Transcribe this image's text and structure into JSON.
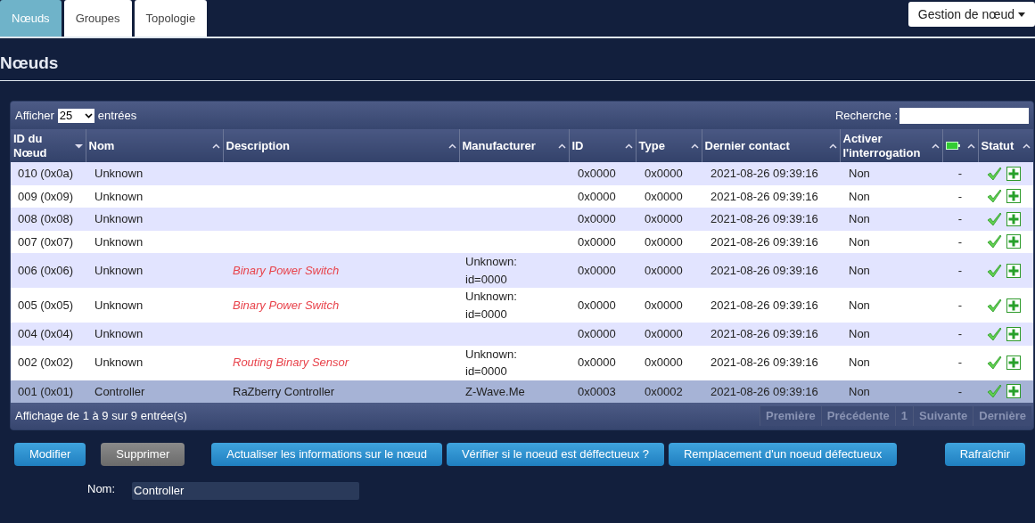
{
  "tabs": [
    {
      "label": "Nœuds",
      "selected": true
    },
    {
      "label": "Groupes",
      "selected": false
    },
    {
      "label": "Topologie",
      "selected": false
    }
  ],
  "menu_button": {
    "label": "Gestion de nœud"
  },
  "heading": "Nœuds",
  "table_controls": {
    "show_label": "Afficher",
    "page_size": "25",
    "entries_label": "entrées",
    "search_label": "Recherche :"
  },
  "table": {
    "columns": [
      {
        "label": "ID du Nœud",
        "sorted_desc": true,
        "kind": "text"
      },
      {
        "label": "Nom",
        "sorted_desc": false,
        "kind": "text"
      },
      {
        "label": "Description",
        "sorted_desc": false,
        "kind": "text"
      },
      {
        "label": "Manufacturer",
        "sorted_desc": false,
        "kind": "text"
      },
      {
        "label": "ID",
        "sorted_desc": false,
        "kind": "text"
      },
      {
        "label": "Type",
        "sorted_desc": false,
        "kind": "text"
      },
      {
        "label": "Dernier contact",
        "sorted_desc": false,
        "kind": "text"
      },
      {
        "label": "Activer l'interrogation",
        "sorted_desc": false,
        "kind": "text"
      },
      {
        "sorted_desc": false,
        "kind": "battery"
      },
      {
        "label": "Statut",
        "sorted_desc": false,
        "kind": "text"
      }
    ],
    "rows": [
      {
        "node_id": "010 (0x0a)",
        "name": "Unknown",
        "id": "0x0000",
        "type": "0x0000",
        "last_contact": "2021-08-26 09:39:16",
        "polling": "Non",
        "battery": "-",
        "selected": false
      },
      {
        "node_id": "009 (0x09)",
        "name": "Unknown",
        "id": "0x0000",
        "type": "0x0000",
        "last_contact": "2021-08-26 09:39:16",
        "polling": "Non",
        "battery": "-",
        "selected": false
      },
      {
        "node_id": "008 (0x08)",
        "name": "Unknown",
        "id": "0x0000",
        "type": "0x0000",
        "last_contact": "2021-08-26 09:39:16",
        "polling": "Non",
        "battery": "-",
        "selected": false
      },
      {
        "node_id": "007 (0x07)",
        "name": "Unknown",
        "id": "0x0000",
        "type": "0x0000",
        "last_contact": "2021-08-26 09:39:16",
        "polling": "Non",
        "battery": "-",
        "selected": false
      },
      {
        "node_id": "006 (0x06)",
        "name": "Unknown",
        "description": "Binary Power Switch",
        "unknown_device": true,
        "manufacturer": "Unknown: id=0000",
        "id": "0x0000",
        "type": "0x0000",
        "last_contact": "2021-08-26 09:39:16",
        "polling": "Non",
        "battery": "-",
        "selected": false
      },
      {
        "node_id": "005 (0x05)",
        "name": "Unknown",
        "description": "Binary Power Switch",
        "unknown_device": true,
        "manufacturer": "Unknown: id=0000",
        "id": "0x0000",
        "type": "0x0000",
        "last_contact": "2021-08-26 09:39:16",
        "polling": "Non",
        "battery": "-",
        "selected": false
      },
      {
        "node_id": "004 (0x04)",
        "name": "Unknown",
        "id": "0x0000",
        "type": "0x0000",
        "last_contact": "2021-08-26 09:39:16",
        "polling": "Non",
        "battery": "-",
        "selected": false
      },
      {
        "node_id": "002 (0x02)",
        "name": "Unknown",
        "description": "Routing Binary Sensor",
        "unknown_device": true,
        "manufacturer": "Unknown: id=0000",
        "id": "0x0000",
        "type": "0x0000",
        "last_contact": "2021-08-26 09:39:16",
        "polling": "Non",
        "battery": "-",
        "selected": false
      },
      {
        "node_id": "001 (0x01)",
        "name": "Controller",
        "description": "RaZberry Controller",
        "unknown_device": false,
        "manufacturer": "Z-Wave.Me",
        "id": "0x0003",
        "type": "0x0002",
        "last_contact": "2021-08-26 09:39:16",
        "polling": "Non",
        "battery": "-",
        "selected": true
      }
    ]
  },
  "table_footer": {
    "info": "Affichage de 1 à 9 sur 9 entrée(s)",
    "pagination": [
      "Première",
      "Précédente",
      "1",
      "Suivante",
      "Dernière"
    ]
  },
  "buttons": [
    {
      "label": "Modifier",
      "disabled": false
    },
    {
      "label": "Supprimer",
      "disabled": true
    },
    {
      "label": "Actualiser les informations sur le nœud",
      "disabled": false
    },
    {
      "label": "Vérifier si le noeud est déffectueux ?",
      "disabled": false
    },
    {
      "label": "Remplacement d'un noeud défectueux",
      "disabled": false
    },
    {
      "label": "Rafraîchir",
      "disabled": false
    }
  ],
  "name_field": {
    "label": "Nom:",
    "value": "Controller"
  }
}
